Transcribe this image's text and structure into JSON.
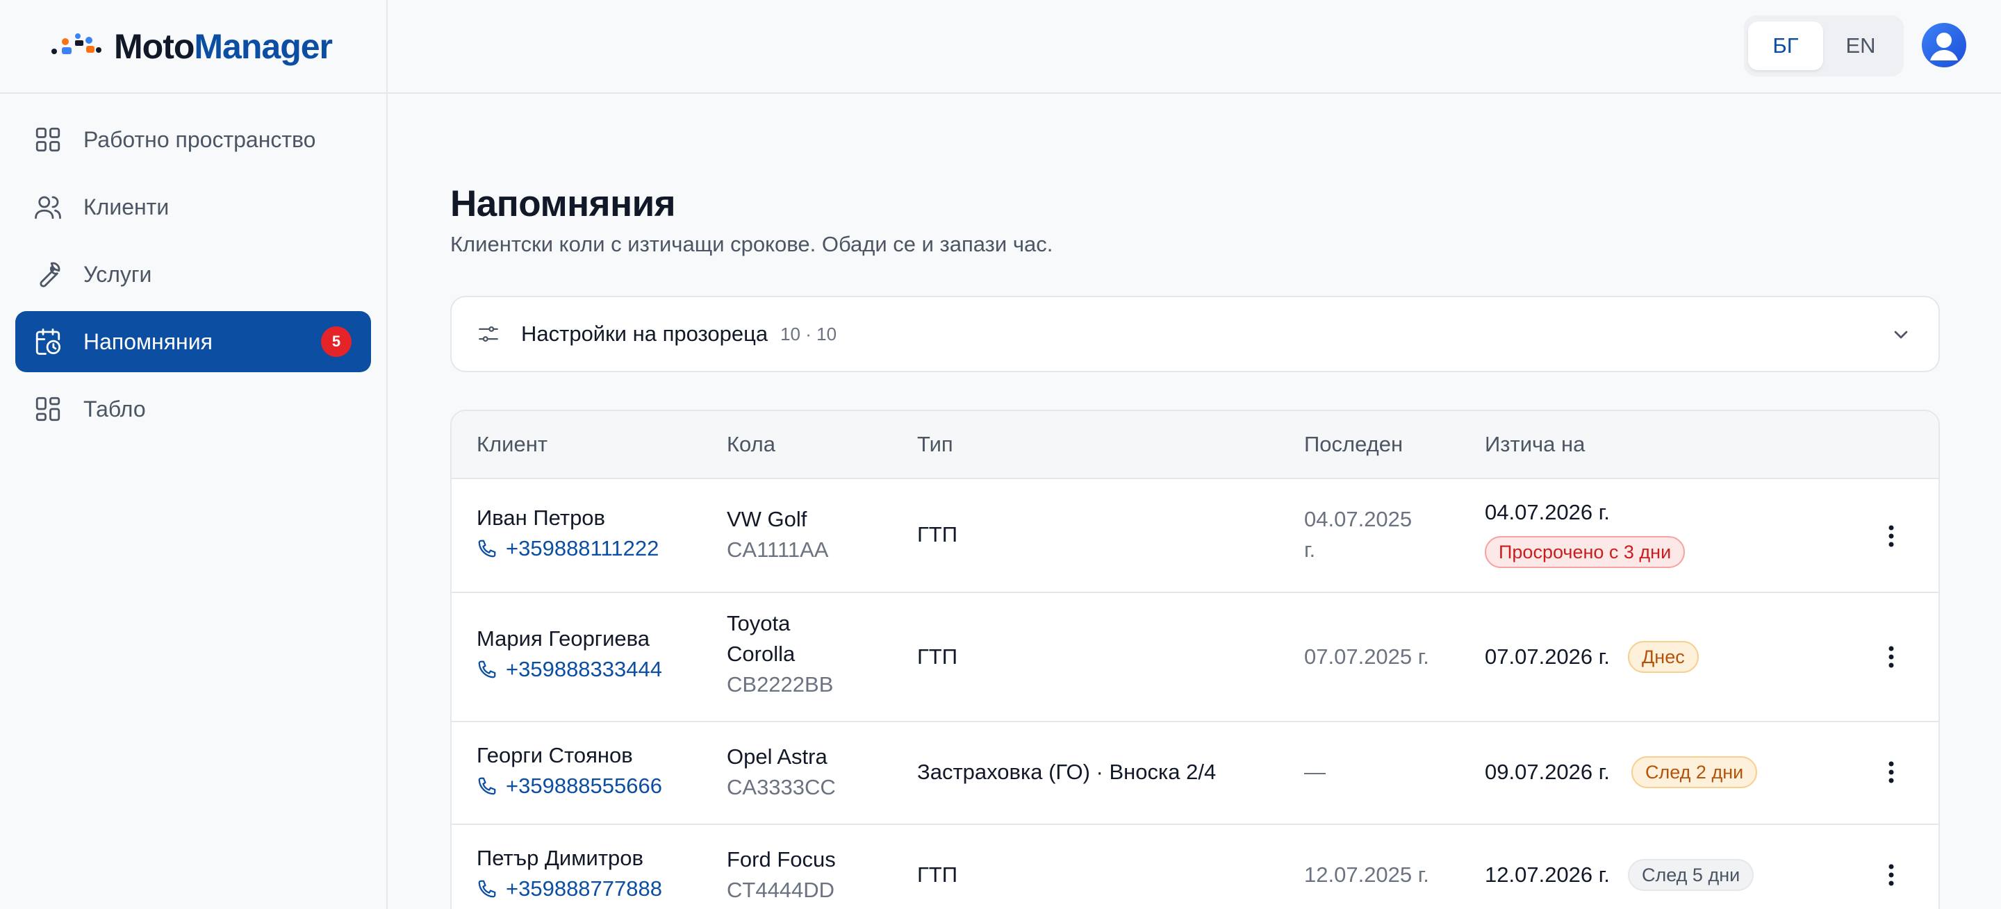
{
  "brand": {
    "name_part1": "Moto",
    "name_part2": "Manager"
  },
  "sidebar": {
    "items": [
      {
        "label": "Работно пространство",
        "icon": "grid-icon"
      },
      {
        "label": "Клиенти",
        "icon": "users-icon"
      },
      {
        "label": "Услуги",
        "icon": "wrench-icon"
      },
      {
        "label": "Напомняния",
        "icon": "calendar-clock-icon",
        "badge": "5",
        "active": true
      },
      {
        "label": "Табло",
        "icon": "dashboard-icon"
      }
    ]
  },
  "header": {
    "lang": {
      "bg": "БГ",
      "en": "EN",
      "active": "БГ"
    }
  },
  "main": {
    "title": "Напомняния",
    "subtitle": "Клиентски коли с изтичащи срокове. Обади се и запази час.",
    "settings": {
      "label": "Настройки на прозореца",
      "meta": "10 · 10"
    },
    "table": {
      "headers": {
        "client": "Клиент",
        "car": "Кола",
        "type": "Тип",
        "last": "Последен",
        "expires": "Изтича на"
      },
      "rows": [
        {
          "name": "Иван Петров",
          "phone": "+359888111222",
          "car_line1": "VW Golf",
          "car_line2": "",
          "plate": "CA1111AA",
          "type": "ГТП",
          "last_line1": "04.07.2025",
          "last_line2": "г.",
          "expires": "04.07.2026 г.",
          "badge": "Просрочено с 3 дни",
          "badge_color": "#c81e1e"
        },
        {
          "name": "Мария Георгиева",
          "phone": "+359888333444",
          "car_line1": "Toyota",
          "car_line2": "Corolla",
          "plate": "CB2222BB",
          "type": "ГТП",
          "last_line1": "07.07.2025 г.",
          "last_line2": "",
          "expires": "07.07.2026 г.",
          "badge": "Днес",
          "badge_color": "#b45309"
        },
        {
          "name": "Георги Стоянов",
          "phone": "+359888555666",
          "car_line1": "Opel Astra",
          "car_line2": "",
          "plate": "CA3333CC",
          "type": "Застраховка (ГО) · Вноска 2/4",
          "last_line1": "—",
          "last_line2": "",
          "expires": "09.07.2026 г.",
          "badge": "След 2 дни",
          "badge_color": "#b45309"
        },
        {
          "name": "Петър Димитров",
          "phone": "+359888777888",
          "car_line1": "Ford Focus",
          "car_line2": "",
          "plate": "CT4444DD",
          "type": "ГТП",
          "last_line1": "12.07.2025 г.",
          "last_line2": "",
          "expires": "12.07.2026 г.",
          "badge": "След 5 дни",
          "badge_color": "#4b5563"
        }
      ]
    }
  },
  "colors": {
    "accent": "#0b4ea2",
    "danger": "#e5242a"
  }
}
